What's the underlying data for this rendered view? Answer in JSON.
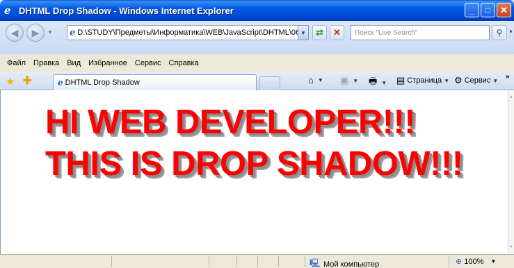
{
  "window": {
    "title": "DHTML Drop Shadow - Windows Internet Explorer",
    "minimize": "_",
    "maximize": "□",
    "close": "✕"
  },
  "nav": {
    "address": "D:\\STUDY\\Предметы\\Информатика\\WEB\\JavaScript\\DHTML\\06",
    "search_placeholder": "Поиск \"Live Search\""
  },
  "menu": [
    "Файл",
    "Правка",
    "Вид",
    "Избранное",
    "Сервис",
    "Справка"
  ],
  "tabs": {
    "active_tab": "DHTML Drop Shadow",
    "page_label": "Страница",
    "tools_label": "Сервис"
  },
  "content": {
    "line1": "HI WEB DEVELOPER!!!",
    "line2": "THIS IS DROP SHADOW!!!",
    "text_color": "#ff0000",
    "shadow_color": "#8c8c8c"
  },
  "status": {
    "zone": "Мой компьютер",
    "zoom": "100%"
  },
  "icons": {
    "back": "back-arrow-icon",
    "forward": "forward-arrow-icon",
    "refresh": "refresh-icon",
    "stop": "stop-icon",
    "search": "search-icon",
    "favorites": "favorites-star-icon",
    "add_favorites": "add-favorites-icon",
    "home": "home-icon",
    "feeds": "feeds-icon",
    "print": "print-icon",
    "page": "page-icon",
    "tools": "gear-icon",
    "computer": "computer-icon",
    "zoom": "zoom-icon"
  }
}
